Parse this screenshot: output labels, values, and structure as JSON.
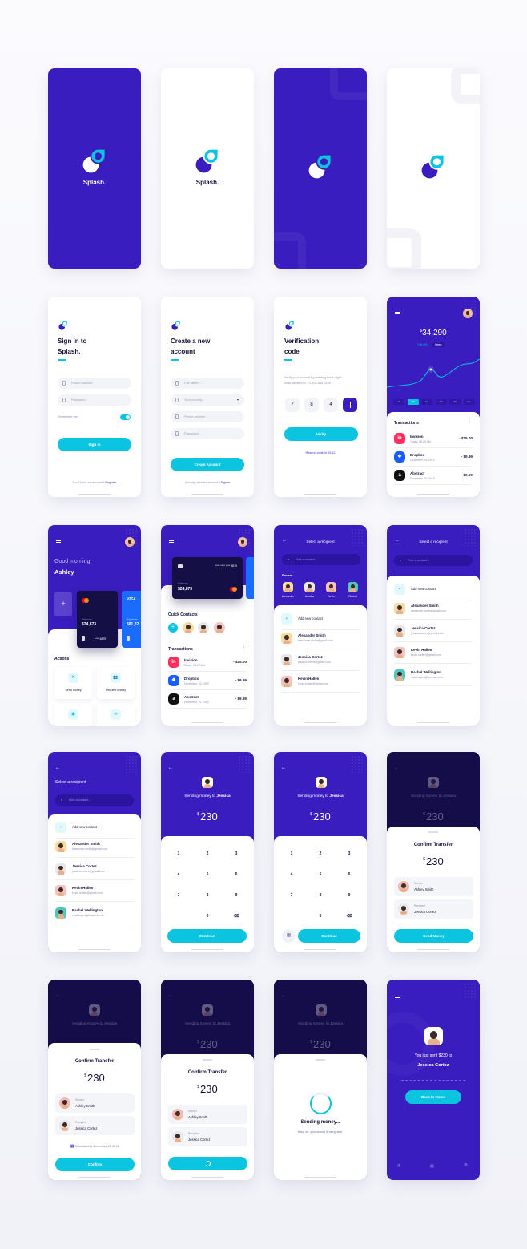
{
  "colors": {
    "primary": "#3a1dbf",
    "accent": "#0bc5e0",
    "dark": "#150c4a",
    "card": "#140f45",
    "visa": "#1a6cff"
  },
  "splash": {
    "brand": "Splash."
  },
  "sign_in": {
    "title_line1": "Sign in to",
    "title_line2": "Splash.",
    "phone_placeholder": "Phone number...",
    "password_placeholder": "Password...",
    "remember": "Remember me",
    "remember_on": true,
    "submit": "Sign in",
    "footer_prompt": "Don't have an account?",
    "footer_link": "Register"
  },
  "create_account": {
    "title_line1": "Create a new",
    "title_line2": "account",
    "name_placeholder": "Full name...",
    "country_placeholder": "Your country...",
    "phone_placeholder": "Phone number...",
    "password_placeholder": "Password...",
    "submit": "Create Account",
    "footer_prompt": "Already have an account?",
    "footer_link": "Sign in"
  },
  "verification": {
    "title_line1": "Verification",
    "title_line2": "code",
    "desc_line1": "Verify your account by entering the 4 digits",
    "desc_line2": "code we sent to:  +1-202-555-0104",
    "digits": [
      "7",
      "8",
      "4",
      ""
    ],
    "submit": "Verify",
    "resend": "Resend code in 00:12"
  },
  "dashboard": {
    "currency": "$",
    "balance": "34,290",
    "change": "+16.4%",
    "period_badge": "Week",
    "periods": [
      "1D",
      "1W",
      "1M",
      "3M",
      "6M",
      "ALL"
    ],
    "active_period": "1W",
    "transactions_title": "Transactions"
  },
  "transactions": [
    {
      "name": "Invision",
      "date": "Today, 08:20 AM",
      "amount": "- $15.00",
      "icon": "invision-icon",
      "glyph": "in",
      "color": "#ff2d5a"
    },
    {
      "name": "Dropbox",
      "date": "December, 02 2019",
      "amount": "- $9.99",
      "icon": "dropbox-icon",
      "glyph": "❖",
      "color": "#1a5cff"
    },
    {
      "name": "Abstract",
      "date": "December, 01 2019",
      "amount": "- $9.99",
      "icon": "abstract-icon",
      "glyph": "a",
      "color": "#111111"
    }
  ],
  "home": {
    "greeting": "Good morning,",
    "name": "Ashley",
    "card_tier": "Platinum",
    "card_balance": "$24,873",
    "card_number": "**** 4879",
    "card2_brand": "VISA",
    "card2_tier": "Signature",
    "card2_balance": "$81,32",
    "actions_title": "Actions",
    "actions": [
      "Send money",
      "Request money"
    ]
  },
  "cards": {
    "card_number": "**** **** **** 4879",
    "card_tier": "Platinum",
    "card_balance": "$24,873",
    "quick_contacts": "Quick Contacts",
    "transactions_title": "Transactions"
  },
  "recipient": {
    "title": "Select a recipient",
    "search_placeholder": "Find a contact...",
    "recent_label": "Recent",
    "recent": [
      "Alexander",
      "Jessica",
      "Kevin",
      "Rachel"
    ],
    "add_contact": "Add new contact"
  },
  "contacts": [
    {
      "name": "Alexander Smith",
      "email": "alexander.smith@gmail.com",
      "color": "#f6dca0"
    },
    {
      "name": "Jessica Cortez",
      "email": "jessica.cortez@gmail.com",
      "color": "#e8e8ea"
    },
    {
      "name": "Kevin Hallen",
      "email": "kevin.hallen@gmail.com",
      "color": "#f5c2c2"
    },
    {
      "name": "Rachel Wellington",
      "email": "r.wellington@hotmail.com",
      "color": "#52c8b8"
    }
  ],
  "send": {
    "to_prefix": "Sending money to",
    "to_name": "Jessica",
    "currency": "$",
    "amount": "230",
    "keys": [
      "1",
      "2",
      "3",
      "4",
      "5",
      "6",
      "7",
      "8",
      "9",
      "",
      "0",
      "⌫"
    ],
    "continue": "Continue"
  },
  "confirm": {
    "title": "Confirm Transfer",
    "sender_label": "Sender",
    "sender_name": "Ashley Smith",
    "recipient_label": "Recipient",
    "recipient_name": "Jessica Cortez",
    "send_money": "Send Money",
    "confirm": "Confirm",
    "scheduled": "Scheduled for December 13, 2019"
  },
  "sending": {
    "title": "Sending money...",
    "subtitle": "Hang on, your money is being sent."
  },
  "success": {
    "line1": "You just sent $230 to",
    "name": "Jessica Cortez",
    "back_home": "Back to Home"
  }
}
